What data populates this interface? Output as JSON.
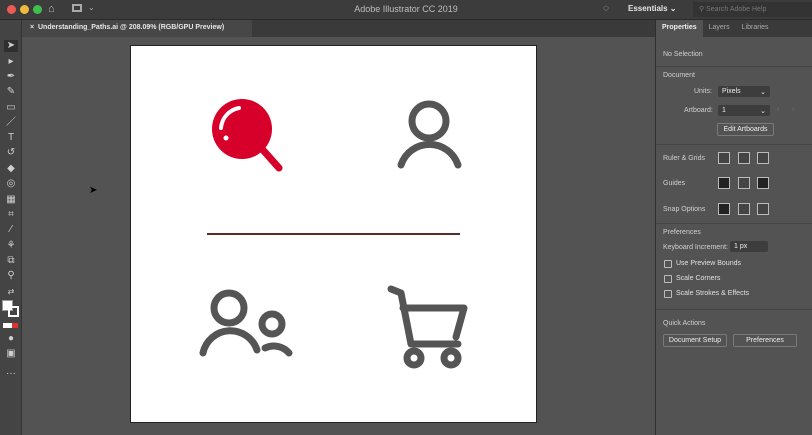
{
  "app": {
    "title": "Adobe Illustrator CC 2019",
    "workspace": "Essentials",
    "search_placeholder": "Search Adobe Help"
  },
  "document_tab": {
    "close": "×",
    "label": "Understanding_Paths.ai @ 208.09% (RGB/GPU Preview)"
  },
  "panel": {
    "tabs": [
      "Properties",
      "Layers",
      "Libraries"
    ],
    "selection": "No Selection",
    "document_heading": "Document",
    "units_label": "Units:",
    "units_value": "Pixels",
    "artboard_label": "Artboard:",
    "artboard_value": "1",
    "edit_artboards": "Edit Artboards",
    "ruler_grids": "Ruler & Grids",
    "guides": "Guides",
    "snap_options": "Snap Options",
    "preferences_heading": "Preferences",
    "keyboard_increment_label": "Keyboard Increment:",
    "keyboard_increment_value": "1 px",
    "checkboxes": [
      "Use Preview Bounds",
      "Scale Corners",
      "Scale Strokes & Effects"
    ],
    "quick_actions": "Quick Actions",
    "document_setup": "Document Setup",
    "preferences_button": "Preferences"
  },
  "colors": {
    "accent_red": "#d7002a",
    "icon_gray": "#555555",
    "line": "#5a2b2b"
  }
}
